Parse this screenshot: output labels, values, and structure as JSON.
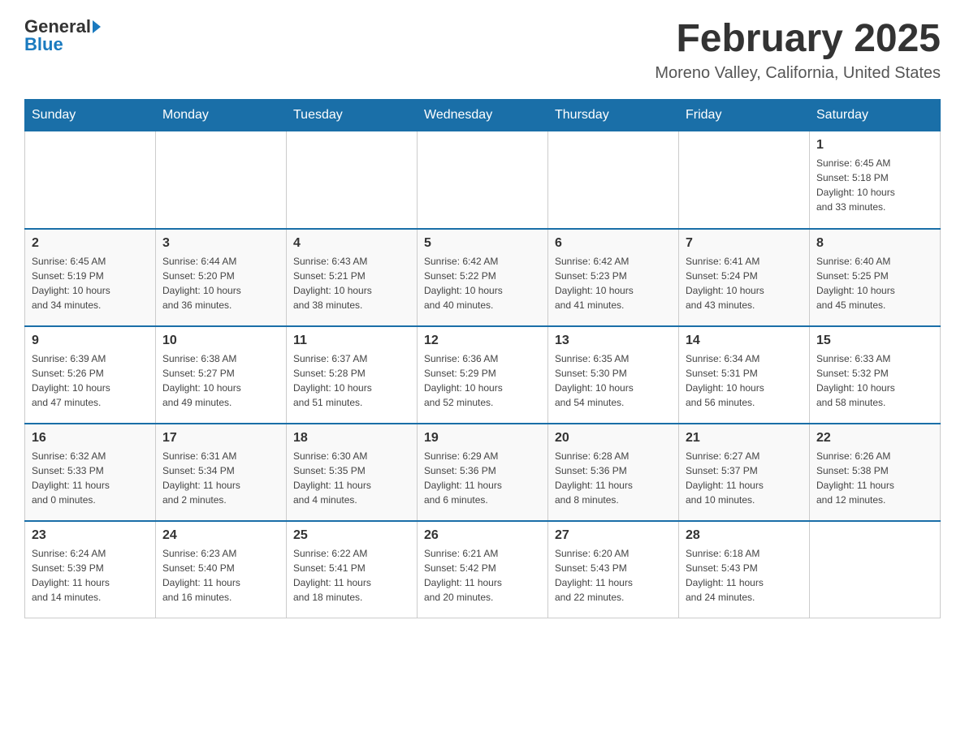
{
  "header": {
    "logo_general": "General",
    "logo_blue": "Blue",
    "month_title": "February 2025",
    "location": "Moreno Valley, California, United States"
  },
  "days_of_week": [
    "Sunday",
    "Monday",
    "Tuesday",
    "Wednesday",
    "Thursday",
    "Friday",
    "Saturday"
  ],
  "weeks": [
    [
      {
        "day": "",
        "info": ""
      },
      {
        "day": "",
        "info": ""
      },
      {
        "day": "",
        "info": ""
      },
      {
        "day": "",
        "info": ""
      },
      {
        "day": "",
        "info": ""
      },
      {
        "day": "",
        "info": ""
      },
      {
        "day": "1",
        "info": "Sunrise: 6:45 AM\nSunset: 5:18 PM\nDaylight: 10 hours\nand 33 minutes."
      }
    ],
    [
      {
        "day": "2",
        "info": "Sunrise: 6:45 AM\nSunset: 5:19 PM\nDaylight: 10 hours\nand 34 minutes."
      },
      {
        "day": "3",
        "info": "Sunrise: 6:44 AM\nSunset: 5:20 PM\nDaylight: 10 hours\nand 36 minutes."
      },
      {
        "day": "4",
        "info": "Sunrise: 6:43 AM\nSunset: 5:21 PM\nDaylight: 10 hours\nand 38 minutes."
      },
      {
        "day": "5",
        "info": "Sunrise: 6:42 AM\nSunset: 5:22 PM\nDaylight: 10 hours\nand 40 minutes."
      },
      {
        "day": "6",
        "info": "Sunrise: 6:42 AM\nSunset: 5:23 PM\nDaylight: 10 hours\nand 41 minutes."
      },
      {
        "day": "7",
        "info": "Sunrise: 6:41 AM\nSunset: 5:24 PM\nDaylight: 10 hours\nand 43 minutes."
      },
      {
        "day": "8",
        "info": "Sunrise: 6:40 AM\nSunset: 5:25 PM\nDaylight: 10 hours\nand 45 minutes."
      }
    ],
    [
      {
        "day": "9",
        "info": "Sunrise: 6:39 AM\nSunset: 5:26 PM\nDaylight: 10 hours\nand 47 minutes."
      },
      {
        "day": "10",
        "info": "Sunrise: 6:38 AM\nSunset: 5:27 PM\nDaylight: 10 hours\nand 49 minutes."
      },
      {
        "day": "11",
        "info": "Sunrise: 6:37 AM\nSunset: 5:28 PM\nDaylight: 10 hours\nand 51 minutes."
      },
      {
        "day": "12",
        "info": "Sunrise: 6:36 AM\nSunset: 5:29 PM\nDaylight: 10 hours\nand 52 minutes."
      },
      {
        "day": "13",
        "info": "Sunrise: 6:35 AM\nSunset: 5:30 PM\nDaylight: 10 hours\nand 54 minutes."
      },
      {
        "day": "14",
        "info": "Sunrise: 6:34 AM\nSunset: 5:31 PM\nDaylight: 10 hours\nand 56 minutes."
      },
      {
        "day": "15",
        "info": "Sunrise: 6:33 AM\nSunset: 5:32 PM\nDaylight: 10 hours\nand 58 minutes."
      }
    ],
    [
      {
        "day": "16",
        "info": "Sunrise: 6:32 AM\nSunset: 5:33 PM\nDaylight: 11 hours\nand 0 minutes."
      },
      {
        "day": "17",
        "info": "Sunrise: 6:31 AM\nSunset: 5:34 PM\nDaylight: 11 hours\nand 2 minutes."
      },
      {
        "day": "18",
        "info": "Sunrise: 6:30 AM\nSunset: 5:35 PM\nDaylight: 11 hours\nand 4 minutes."
      },
      {
        "day": "19",
        "info": "Sunrise: 6:29 AM\nSunset: 5:36 PM\nDaylight: 11 hours\nand 6 minutes."
      },
      {
        "day": "20",
        "info": "Sunrise: 6:28 AM\nSunset: 5:36 PM\nDaylight: 11 hours\nand 8 minutes."
      },
      {
        "day": "21",
        "info": "Sunrise: 6:27 AM\nSunset: 5:37 PM\nDaylight: 11 hours\nand 10 minutes."
      },
      {
        "day": "22",
        "info": "Sunrise: 6:26 AM\nSunset: 5:38 PM\nDaylight: 11 hours\nand 12 minutes."
      }
    ],
    [
      {
        "day": "23",
        "info": "Sunrise: 6:24 AM\nSunset: 5:39 PM\nDaylight: 11 hours\nand 14 minutes."
      },
      {
        "day": "24",
        "info": "Sunrise: 6:23 AM\nSunset: 5:40 PM\nDaylight: 11 hours\nand 16 minutes."
      },
      {
        "day": "25",
        "info": "Sunrise: 6:22 AM\nSunset: 5:41 PM\nDaylight: 11 hours\nand 18 minutes."
      },
      {
        "day": "26",
        "info": "Sunrise: 6:21 AM\nSunset: 5:42 PM\nDaylight: 11 hours\nand 20 minutes."
      },
      {
        "day": "27",
        "info": "Sunrise: 6:20 AM\nSunset: 5:43 PM\nDaylight: 11 hours\nand 22 minutes."
      },
      {
        "day": "28",
        "info": "Sunrise: 6:18 AM\nSunset: 5:43 PM\nDaylight: 11 hours\nand 24 minutes."
      },
      {
        "day": "",
        "info": ""
      }
    ]
  ]
}
